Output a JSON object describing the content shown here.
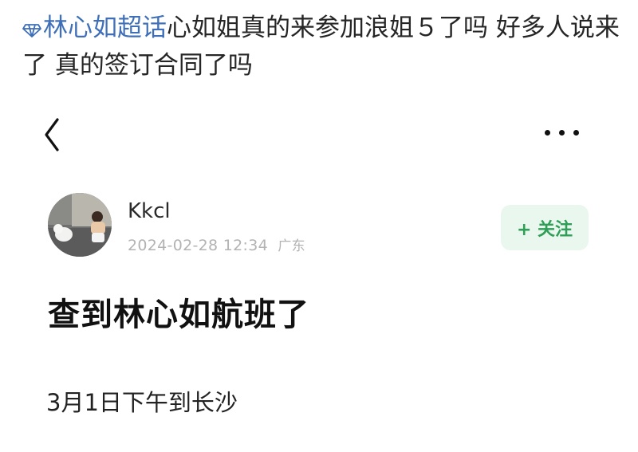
{
  "caption": {
    "topic": "林心如超话",
    "text": "心如姐真的来参加浪姐５了吗 好多人说来了 真的签订合同了吗"
  },
  "nav": {
    "back_icon": "chevron-left-icon",
    "more_icon": "more-dots-icon"
  },
  "post": {
    "author": "Kkcl",
    "timestamp": "2024-02-28 12:34",
    "location": "广东",
    "follow_label": "+ 关注",
    "title": "查到林心如航班了",
    "body": "3月1日下午到长沙"
  },
  "colors": {
    "topic": "#3f6fb8",
    "follow_bg": "#eaf7ee",
    "follow_text": "#2f9e57"
  }
}
